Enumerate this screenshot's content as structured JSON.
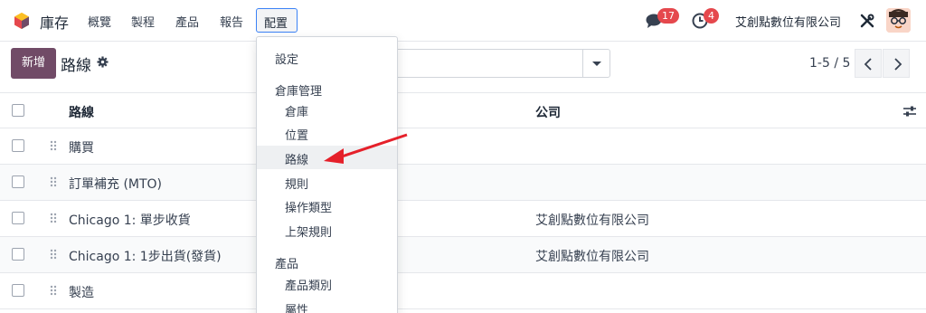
{
  "navbar": {
    "app_name": "庫存",
    "menu": [
      "概覽",
      "製程",
      "產品",
      "報告"
    ],
    "active_menu": "配置",
    "messages_count": "17",
    "activities_count": "4",
    "company": "艾創點數位有限公司"
  },
  "control": {
    "new_button": "新增",
    "breadcrumb": "路線",
    "pager": "1-5 / 5"
  },
  "table": {
    "headers": {
      "name": "路線",
      "company": "公司"
    },
    "rows": [
      {
        "name": "購買",
        "company": ""
      },
      {
        "name": "訂單補充 (MTO)",
        "company": ""
      },
      {
        "name": "Chicago 1: 單步收貨",
        "company": "艾創點數位有限公司"
      },
      {
        "name": "Chicago 1: 1步出貨(發貨)",
        "company": "艾創點數位有限公司"
      },
      {
        "name": "製造",
        "company": ""
      }
    ]
  },
  "dropdown": {
    "settings": "設定",
    "warehouse_header": "倉庫管理",
    "warehouse_items": [
      "倉庫",
      "位置",
      "路線",
      "規則",
      "操作類型",
      "上架規則"
    ],
    "product_header": "產品",
    "product_items": [
      "產品類別",
      "屬性"
    ]
  },
  "colors": {
    "primary": "#714b67",
    "badge": "#e5484d",
    "arrow": "#e5202a"
  }
}
